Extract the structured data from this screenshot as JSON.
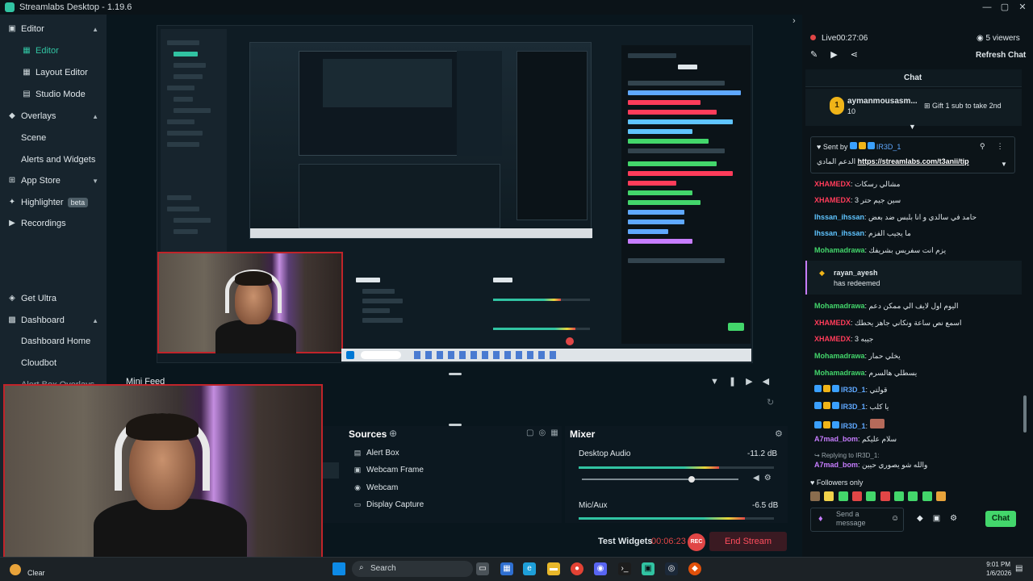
{
  "window": {
    "title": "Streamlabs Desktop - 1.19.6",
    "min": "—",
    "max": "▢",
    "close": "✕"
  },
  "nav": {
    "editor": "Editor",
    "editor_sub": "Editor",
    "layout_editor": "Layout Editor",
    "studio_mode": "Studio Mode",
    "overlays": "Overlays",
    "scene": "Scene",
    "alerts_widgets": "Alerts and Widgets",
    "app_store": "App Store",
    "highlighter": "Highlighter",
    "highlighter_badge": "beta",
    "recordings": "Recordings",
    "get_ultra": "Get Ultra",
    "dashboard": "Dashboard",
    "dashboard_home": "Dashboard Home",
    "cloudbot": "Cloudbot",
    "more_overlays": "Alert Box Overlays"
  },
  "editor": {
    "mini_feed": "Mini Feed",
    "sources_title": "Sources",
    "sources": [
      "Alert Box",
      "Webcam Frame",
      "Webcam",
      "Display Capture"
    ],
    "mixer_title": "Mixer",
    "desktop_audio": "Desktop Audio",
    "desktop_db": "-11.2 dB",
    "mic_aux": "Mic/Aux",
    "mic_db": "-6.5 dB",
    "desktop_level": 0.72,
    "mic_level": 0.85,
    "test_widgets": "Test Widgets",
    "timer": "00:06:23",
    "rec_label": "REC",
    "end_stream": "End Stream"
  },
  "chat": {
    "live_label": "Live",
    "live_time": "00:27:06",
    "viewers": "5 viewers",
    "refresh": "Refresh Chat",
    "title": "Chat",
    "gift_user": "aymanmousasm...",
    "gift_count": "10",
    "gift_text": "Gift 1 sub to take 2nd",
    "pinned_sender_prefix": "Sent by",
    "pinned_sender": "IR3D_1",
    "pinned_link": "https://streamlabs.com/t3anii/tip",
    "pinned_tail": "الدعم المادي",
    "redeem_user": "rayan_ayesh",
    "redeem_text": "has redeemed",
    "messages": [
      {
        "user": "XHAMEDX",
        "text": "مشالي رسكات",
        "color": "#ff3c5a"
      },
      {
        "user": "XHAMEDX",
        "text": "سين جيم حتر 3",
        "color": "#ff3c5a"
      },
      {
        "user": "Ihssan_ihssan",
        "text": "حامد في سالدي و انا بلبس ضد بعض",
        "color": "#5fc4ff"
      },
      {
        "user": "Ihssan_ihssan",
        "text": "ما يجيب الفزم",
        "color": "#5fc4ff"
      },
      {
        "user": "Mohamadrawa",
        "text": "يزم انت سفريس بشريفك",
        "color": "#43d66b"
      },
      {
        "user": "Mohamadrawa",
        "text": "اليوم اول لايف الي ممكن دعم",
        "color": "#43d66b"
      },
      {
        "user": "XHAMEDX",
        "text": "اسمع نص ساعة ونكاني جاهز يحطك",
        "color": "#ff3c5a"
      },
      {
        "user": "XHAMEDX",
        "text": "جيبه 3",
        "color": "#ff3c5a"
      },
      {
        "user": "Mohamadrawa",
        "text": "يخلي حمار",
        "color": "#43d66b"
      },
      {
        "user": "Mohamadrawa",
        "text": "يسطلي هالسرم",
        "color": "#43d66b"
      },
      {
        "user": "IR3D_1",
        "text": "قولتي",
        "color": "#5fa8ff"
      },
      {
        "user": "IR3D_1",
        "text": "يا كلب",
        "color": "#5fa8ff"
      },
      {
        "user": "IR3D_1",
        "text": "",
        "color": "#5fa8ff"
      },
      {
        "user": "A7mad_bom",
        "text": "سلام عليكم",
        "color": "#c77dff"
      }
    ],
    "reply_to": "Replying to IR3D_1:",
    "reply_user": "A7mad_bom",
    "reply_text": "والله شو يصوري حيين",
    "followers_only": "Followers only",
    "input_placeholder": "Send a message",
    "chat_button": "Chat"
  },
  "taskbar": {
    "clear": "Clear",
    "search": "Search",
    "time": "9:01 PM",
    "date": "1/6/2026"
  },
  "colors": {
    "accent": "#31c3a2",
    "live_red": "#e04646",
    "chat_green": "#43d66b"
  }
}
